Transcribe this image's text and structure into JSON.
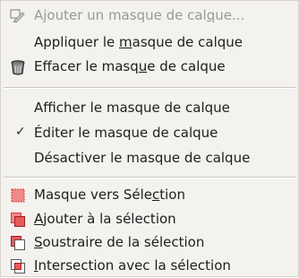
{
  "menu": {
    "items": [
      {
        "id": "add-mask",
        "pre": "Ajouter un masque de cal",
        "mn": "q",
        "post": "ue...",
        "enabled": false,
        "icon": "add-layer-mask-icon"
      },
      {
        "id": "apply-mask",
        "pre": "Appliquer le ",
        "mn": "m",
        "post": "asque de calque",
        "enabled": true,
        "icon": ""
      },
      {
        "id": "delete-mask",
        "pre": "Effacer le masq",
        "mn": "u",
        "post": "e de calque",
        "enabled": true,
        "icon": "trash-can-icon"
      },
      {
        "id": "show-mask",
        "pre": "Afficher le masque de calque",
        "mn": "",
        "post": "",
        "enabled": true,
        "icon": ""
      },
      {
        "id": "edit-mask",
        "pre": "Éditer le masque de calque",
        "mn": "",
        "post": "",
        "enabled": true,
        "icon": "",
        "checked": true
      },
      {
        "id": "disable-mask",
        "pre": "Désactiver le masque de calque",
        "mn": "",
        "post": "",
        "enabled": true,
        "icon": ""
      },
      {
        "id": "mask-to-selection",
        "pre": "Masque vers Séle",
        "mn": "c",
        "post": "tion",
        "enabled": true,
        "icon": "mask-to-selection-icon"
      },
      {
        "id": "add-to-selection",
        "pre": "",
        "mn": "A",
        "post": "jouter à la sélection",
        "enabled": true,
        "icon": "selection-add-icon"
      },
      {
        "id": "subtract-from-selection",
        "pre": "",
        "mn": "S",
        "post": "oustraire de la sélection",
        "enabled": true,
        "icon": "selection-subtract-icon"
      },
      {
        "id": "intersect-with-selection",
        "pre": "",
        "mn": "I",
        "post": "ntersection avec la sélection",
        "enabled": true,
        "icon": "selection-intersect-icon"
      }
    ],
    "check_mark": "✓"
  },
  "colors": {
    "menu_background": "#f4f2ee",
    "text": "#1e1e1e",
    "disabled_text": "#9a9894",
    "selection_icon_pink": "#f08a8a",
    "selection_icon_red": "#d23c3c"
  }
}
